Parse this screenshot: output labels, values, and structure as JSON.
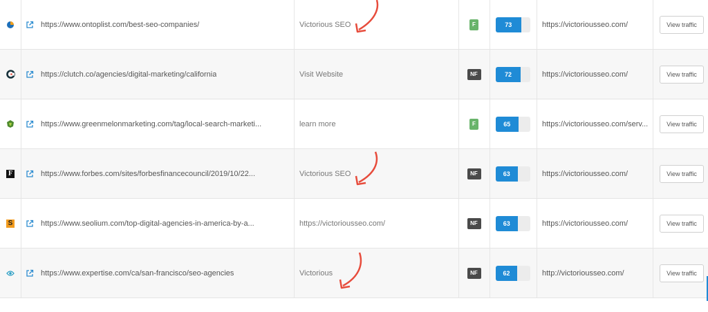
{
  "colors": {
    "follow_badge": "#69b46b",
    "nofollow_badge": "#4a4a4a",
    "domain_rating": "#1f8bd6",
    "annotation_arrow": "#e74c3c"
  },
  "rows": [
    {
      "favicon": "ontoplist-icon",
      "source_url": "https://www.ontoplist.com/best-seo-companies/",
      "anchor": "Victorious SEO",
      "link_type": "F",
      "domain_rating": 73,
      "target_url": "https://victoriousseo.com/",
      "action": "View traffic"
    },
    {
      "favicon": "clutch-icon",
      "source_url": "https://clutch.co/agencies/digital-marketing/california",
      "anchor": "Visit Website",
      "link_type": "NF",
      "domain_rating": 72,
      "target_url": "https://victoriousseo.com/",
      "action": "View traffic"
    },
    {
      "favicon": "greenmelon-icon",
      "source_url": "https://www.greenmelonmarketing.com/tag/local-search-marketi...",
      "anchor": "learn more",
      "link_type": "F",
      "domain_rating": 65,
      "target_url": "https://victoriousseo.com/serv...",
      "action": "View traffic"
    },
    {
      "favicon": "forbes-icon",
      "source_url": "https://www.forbes.com/sites/forbesfinancecouncil/2019/10/22...",
      "anchor": "Victorious SEO",
      "link_type": "NF",
      "domain_rating": 63,
      "target_url": "https://victoriousseo.com/",
      "action": "View traffic"
    },
    {
      "favicon": "seolium-icon",
      "source_url": "https://www.seolium.com/top-digital-agencies-in-america-by-a...",
      "anchor": "https://victoriousseo.com/",
      "link_type": "NF",
      "domain_rating": 63,
      "target_url": "https://victoriousseo.com/",
      "action": "View traffic"
    },
    {
      "favicon": "expertise-icon",
      "source_url": "https://www.expertise.com/ca/san-francisco/seo-agencies",
      "anchor": "Victorious",
      "link_type": "NF",
      "domain_rating": 62,
      "target_url": "http://victoriousseo.com/",
      "action": "View traffic"
    }
  ]
}
